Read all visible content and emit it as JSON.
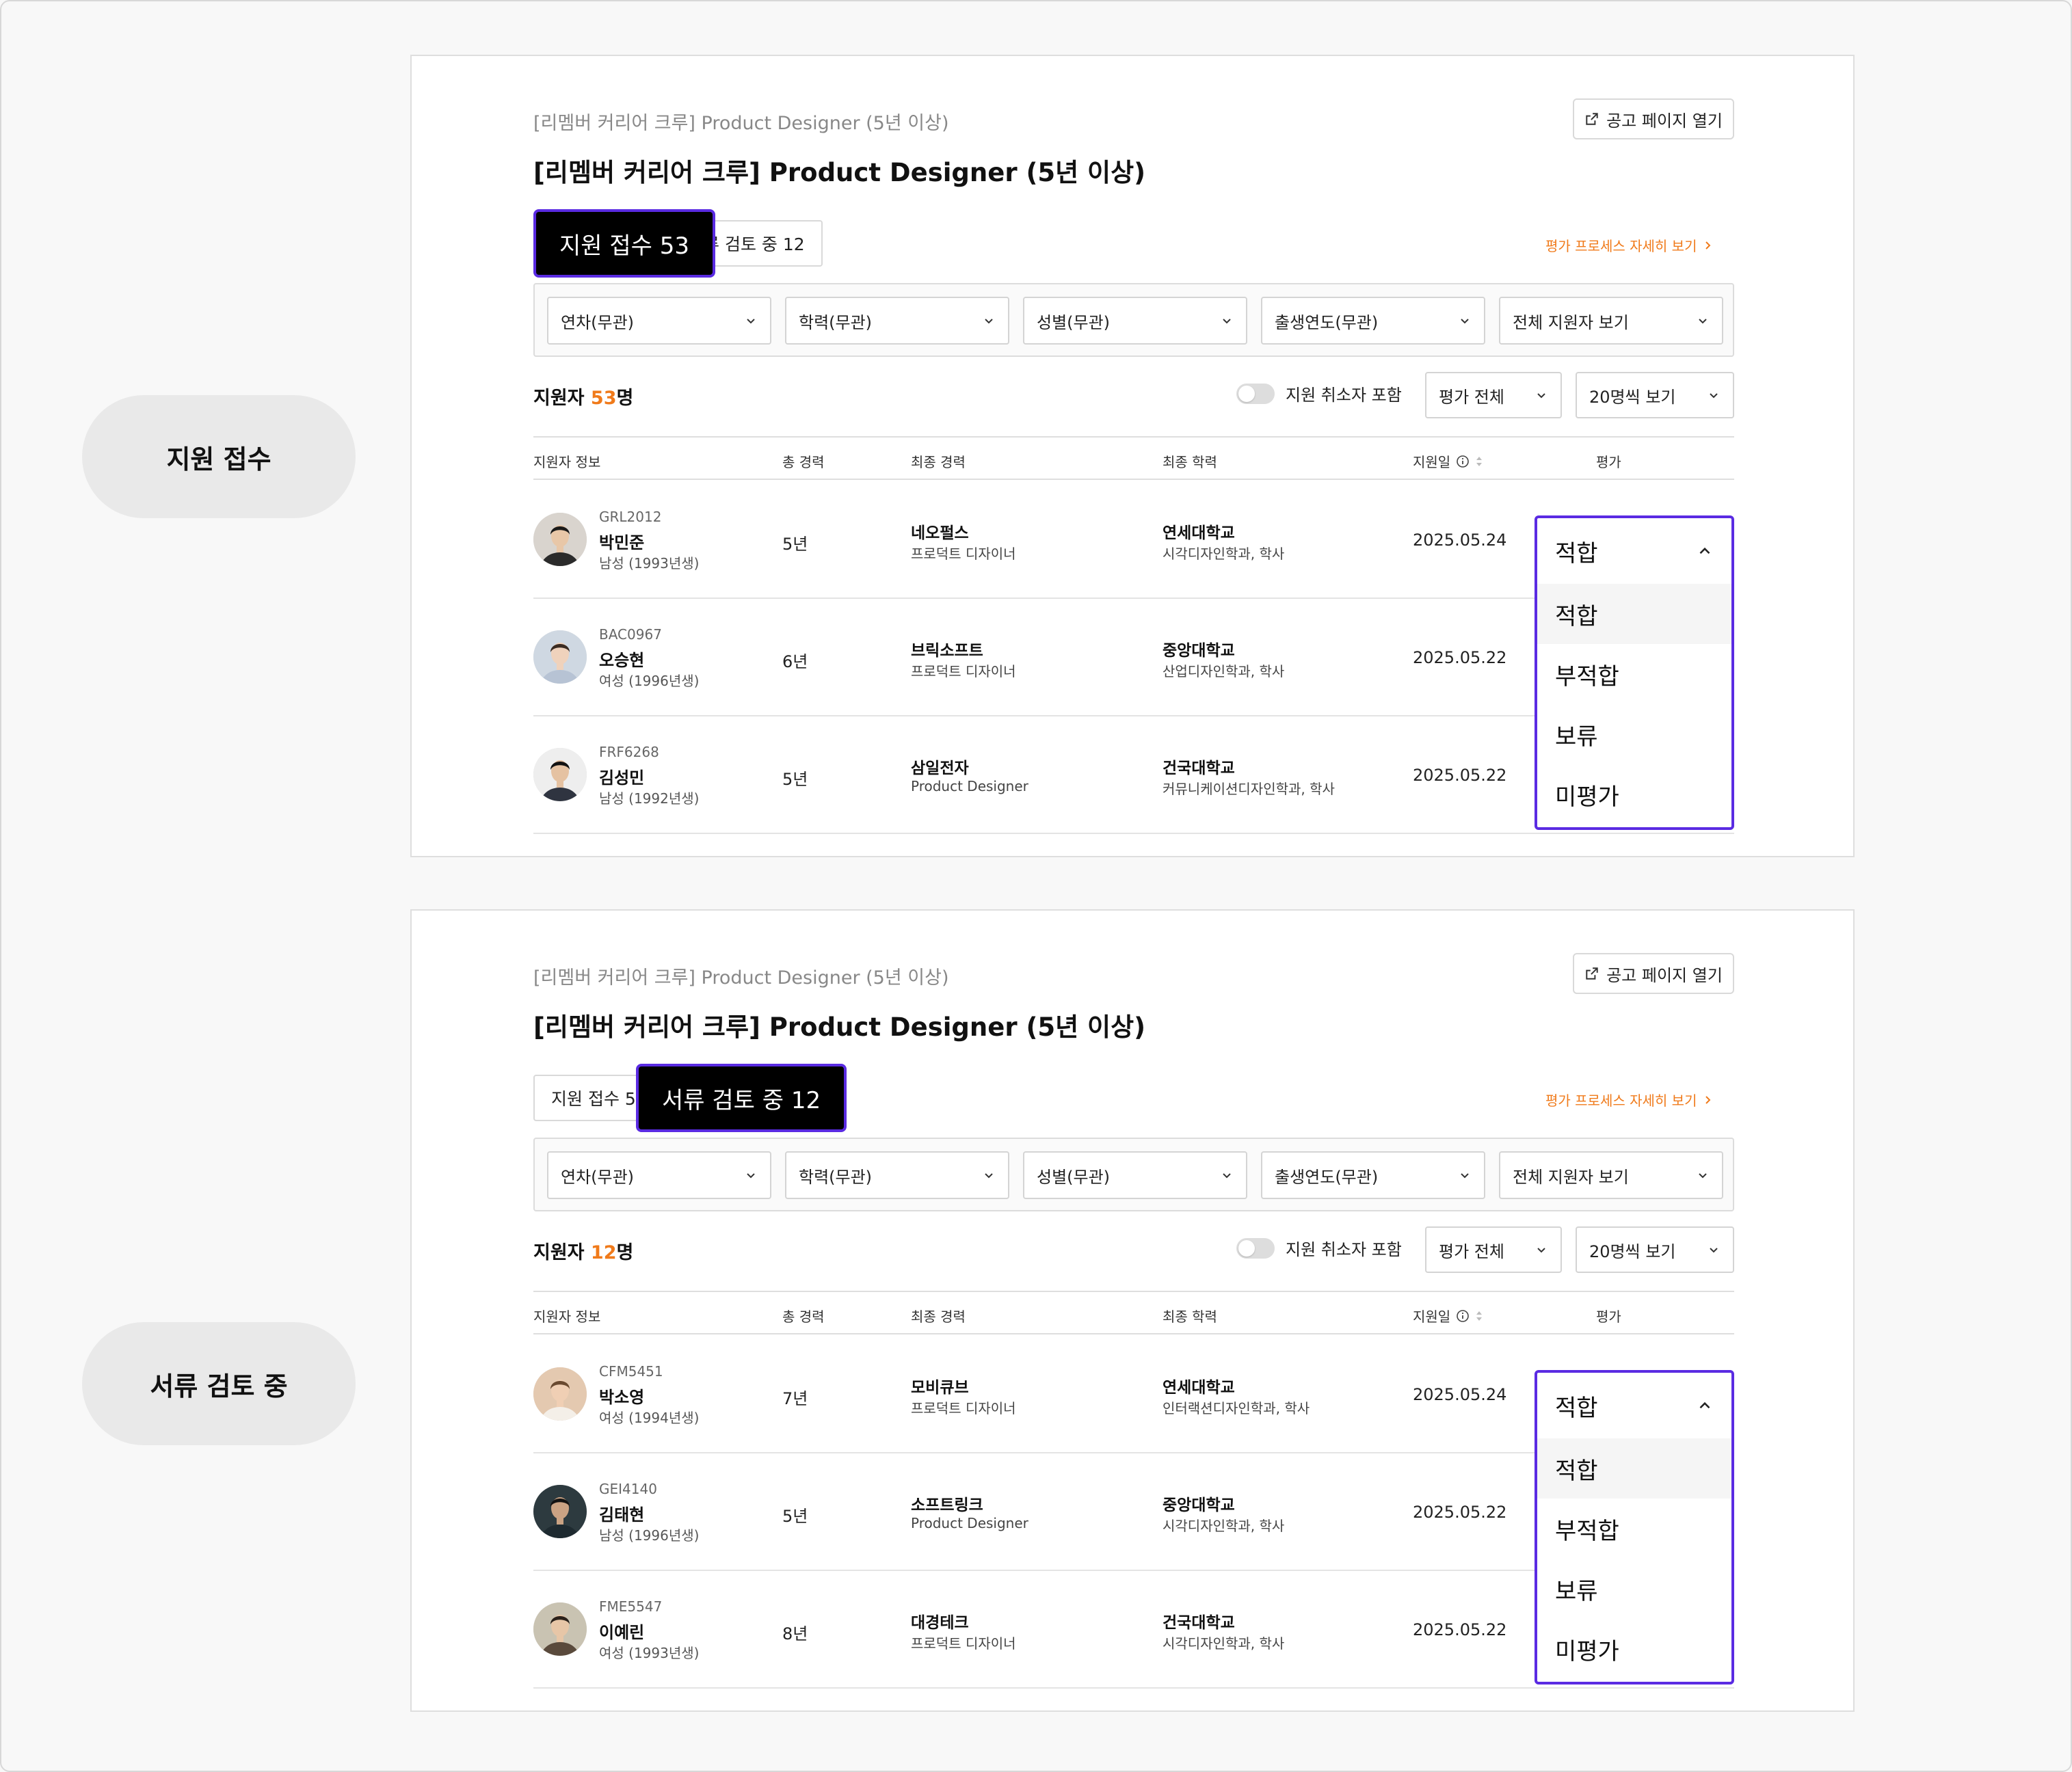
{
  "sections": [
    {
      "stage_label": "지원 접수",
      "breadcrumb": "[리멤버 커리어 크루] Product Designer (5년 이상)",
      "title": "[리멤버 커리어 크루] Product Designer (5년 이상)",
      "open_button": "공고 페이지 열기",
      "tabs": [
        {
          "label": "지원 접수 53",
          "highlight": true
        },
        {
          "label": "서류 검토 중 12",
          "highlight": false
        }
      ],
      "process_link": "평가 프로세스 자세히 보기",
      "filters": [
        "연차(무관)",
        "학력(무관)",
        "성별(무관)",
        "출생연도(무관)",
        "전체 지원자 보기"
      ],
      "count_prefix": "지원자 ",
      "count_value": "53",
      "count_suffix": "명",
      "toggle_label": "지원 취소자 포함",
      "eval_filter": "평가 전체",
      "per_page": "20명씩 보기",
      "headers": [
        "지원자 정보",
        "총 경력",
        "최종 경력",
        "최종 학력",
        "지원일",
        "평가"
      ],
      "rows": [
        {
          "id": "GRL2012",
          "name": "박민준",
          "meta": "남성 (1993년생)",
          "years": "5년",
          "company": "네오펄스",
          "role": "프로덕트 디자이너",
          "school": "연세대학교",
          "major": "시각디자인학과, 학사",
          "date": "2025.05.24",
          "avatar": "male-short-hair-icon"
        },
        {
          "id": "BAC0967",
          "name": "오승현",
          "meta": "여성 (1996년생)",
          "years": "6년",
          "company": "브릭소프트",
          "role": "프로덕트 디자이너",
          "school": "중앙대학교",
          "major": "산업디자인학과, 학사",
          "date": "2025.05.22",
          "avatar": "female-long-hair-icon"
        },
        {
          "id": "FRF6268",
          "name": "김성민",
          "meta": "남성 (1992년생)",
          "years": "5년",
          "company": "삼일전자",
          "role": "Product Designer",
          "school": "건국대학교",
          "major": "커뮤니케이션디자인학과, 학사",
          "date": "2025.05.22",
          "avatar": "male-suit-icon"
        }
      ],
      "dropdown": {
        "selected": "적합",
        "options": [
          "적합",
          "부적합",
          "보류",
          "미평가"
        ]
      }
    },
    {
      "stage_label": "서류 검토 중",
      "breadcrumb": "[리멤버 커리어 크루] Product Designer (5년 이상)",
      "title": "[리멤버 커리어 크루] Product Designer (5년 이상)",
      "open_button": "공고 페이지 열기",
      "tabs": [
        {
          "label": "지원 접수 53",
          "highlight": false
        },
        {
          "label": "서류 검토 중 12",
          "highlight": true
        }
      ],
      "process_link": "평가 프로세스 자세히 보기",
      "filters": [
        "연차(무관)",
        "학력(무관)",
        "성별(무관)",
        "출생연도(무관)",
        "전체 지원자 보기"
      ],
      "count_prefix": "지원자 ",
      "count_value": "12",
      "count_suffix": "명",
      "toggle_label": "지원 취소자 포함",
      "eval_filter": "평가 전체",
      "per_page": "20명씩 보기",
      "headers": [
        "지원자 정보",
        "총 경력",
        "최종 경력",
        "최종 학력",
        "지원일",
        "평가"
      ],
      "rows": [
        {
          "id": "CFM5451",
          "name": "박소영",
          "meta": "여성 (1994년생)",
          "years": "7년",
          "company": "모비큐브",
          "role": "프로덕트 디자이너",
          "school": "연세대학교",
          "major": "인터랙션디자인학과, 학사",
          "date": "2025.05.24",
          "avatar": "female-smiling-icon"
        },
        {
          "id": "GEI4140",
          "name": "김태현",
          "meta": "남성 (1996년생)",
          "years": "5년",
          "company": "소프트링크",
          "role": "Product Designer",
          "school": "중앙대학교",
          "major": "시각디자인학과, 학사",
          "date": "2025.05.22",
          "avatar": "male-dark-bg-icon"
        },
        {
          "id": "FME5547",
          "name": "이예린",
          "meta": "여성 (1993년생)",
          "years": "8년",
          "company": "대경테크",
          "role": "프로덕트 디자이너",
          "school": "건국대학교",
          "major": "시각디자인학과, 학사",
          "date": "2025.05.22",
          "avatar": "female-outdoor-icon"
        }
      ],
      "dropdown": {
        "selected": "적합",
        "options": [
          "적합",
          "부적합",
          "보류",
          "미평가"
        ]
      }
    }
  ],
  "colors": {
    "accent": "#f07a1a",
    "highlight_border": "#5a2be2",
    "tab_highlight_bg": "#000000"
  },
  "icons": [
    "external-link-icon",
    "chevron-down-icon",
    "chevron-up-icon",
    "chevron-right-icon",
    "info-icon",
    "sort-icon"
  ]
}
